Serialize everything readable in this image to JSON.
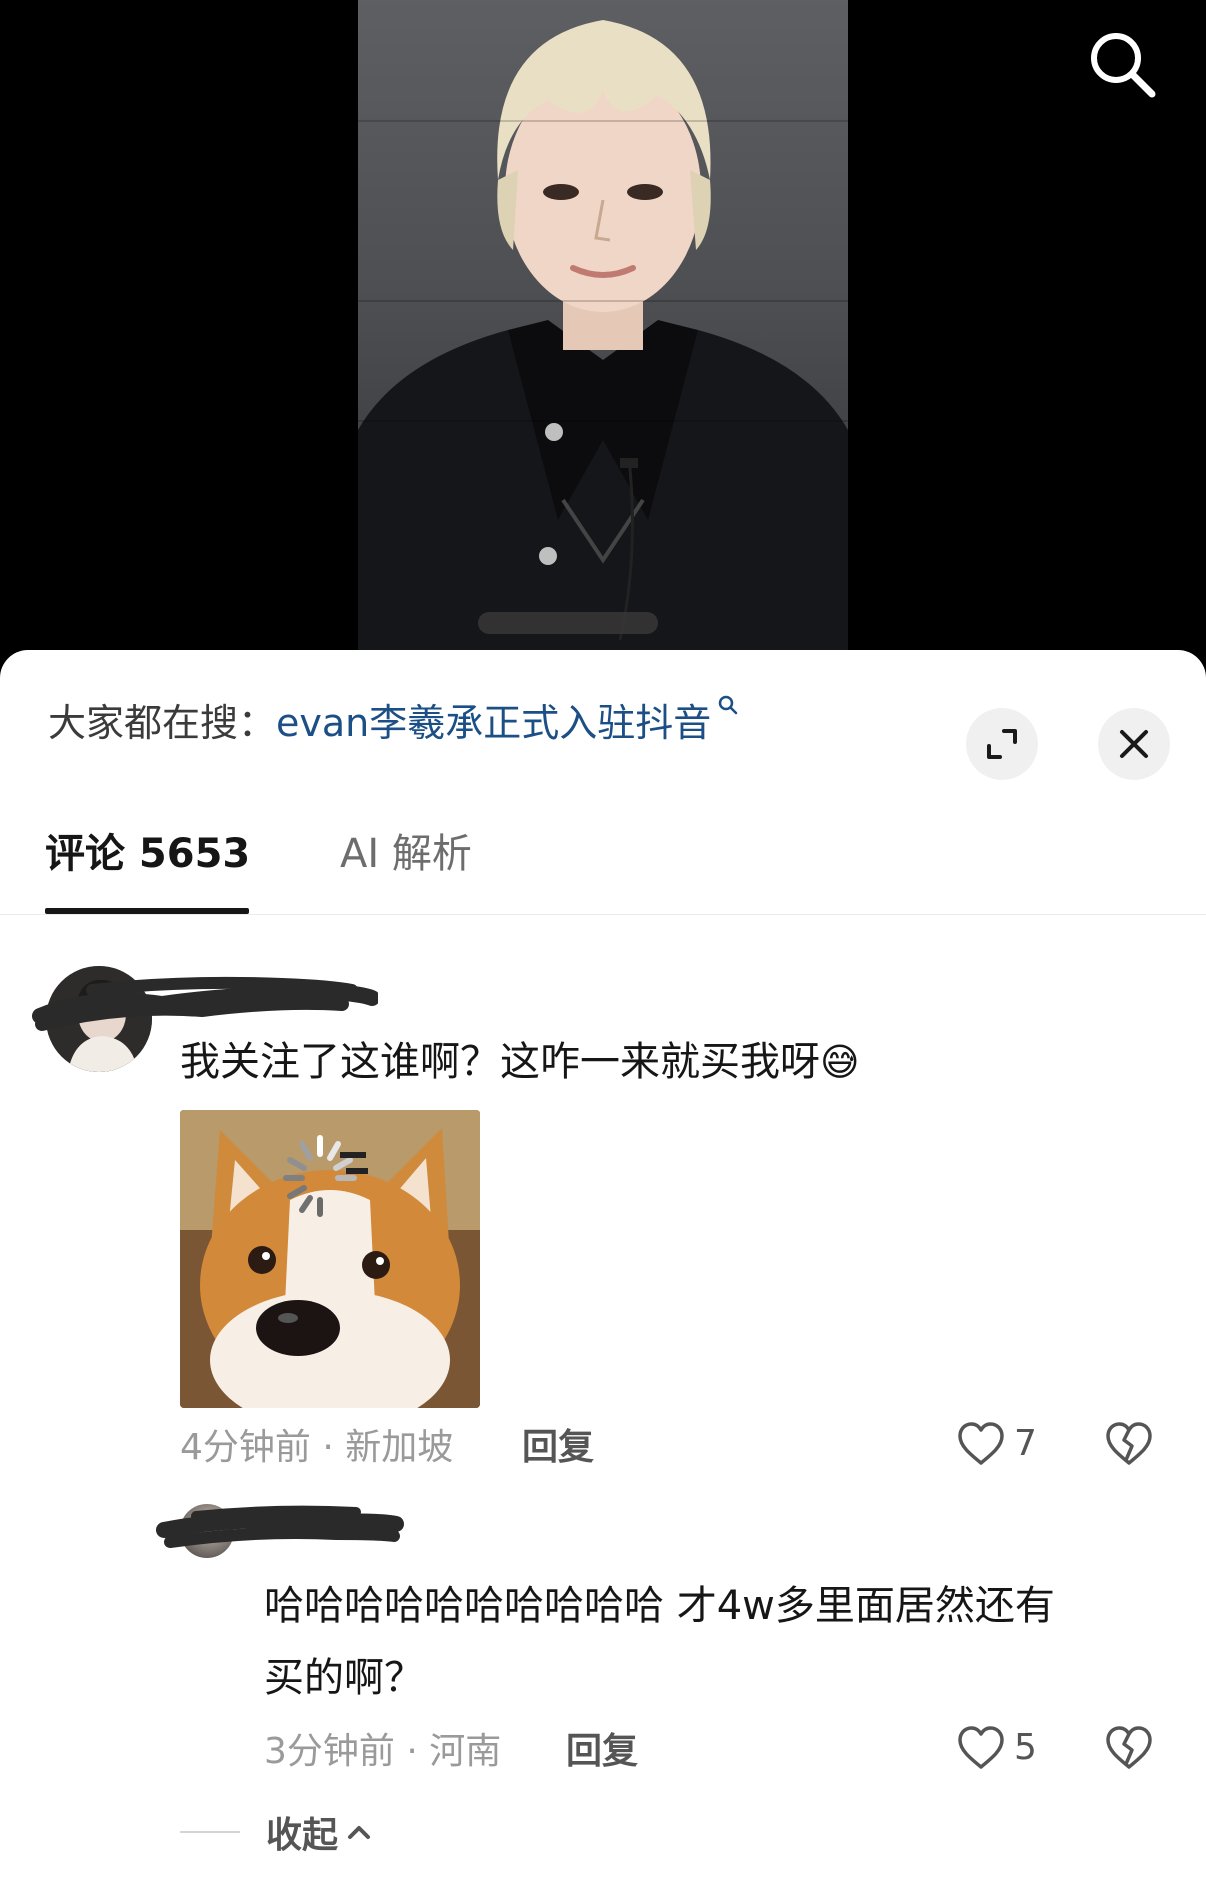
{
  "search_hint": {
    "prefix": "大家都在搜：",
    "query": "evan李羲承正式入驻抖音"
  },
  "tabs": [
    {
      "label": "评论 5653",
      "active": true
    },
    {
      "label": "AI 解析",
      "active": false
    }
  ],
  "comments": [
    {
      "text": "我关注了这谁啊？这咋一来就买我呀",
      "emoji": "😅",
      "time": "4分钟前 · 新加坡",
      "reply_label": "回复",
      "likes": "7",
      "has_sticker": true
    },
    {
      "text_line1": "哈哈哈哈哈哈哈哈哈哈 才4w多里面居然还有",
      "text_line2": "买的啊？",
      "time": "3分钟前 · 河南",
      "reply_label": "回复",
      "likes": "5"
    }
  ],
  "collapse_label": "收起",
  "colors": {
    "query_blue": "#1b4f86",
    "text_dark": "#161616",
    "meta_gray": "#9a9a9a"
  },
  "icons": {
    "search": "search-icon",
    "expand": "expand-icon",
    "close": "close-icon",
    "like": "heart-outline-icon",
    "dislike": "broken-heart-icon",
    "collapse": "chevron-up-icon"
  }
}
